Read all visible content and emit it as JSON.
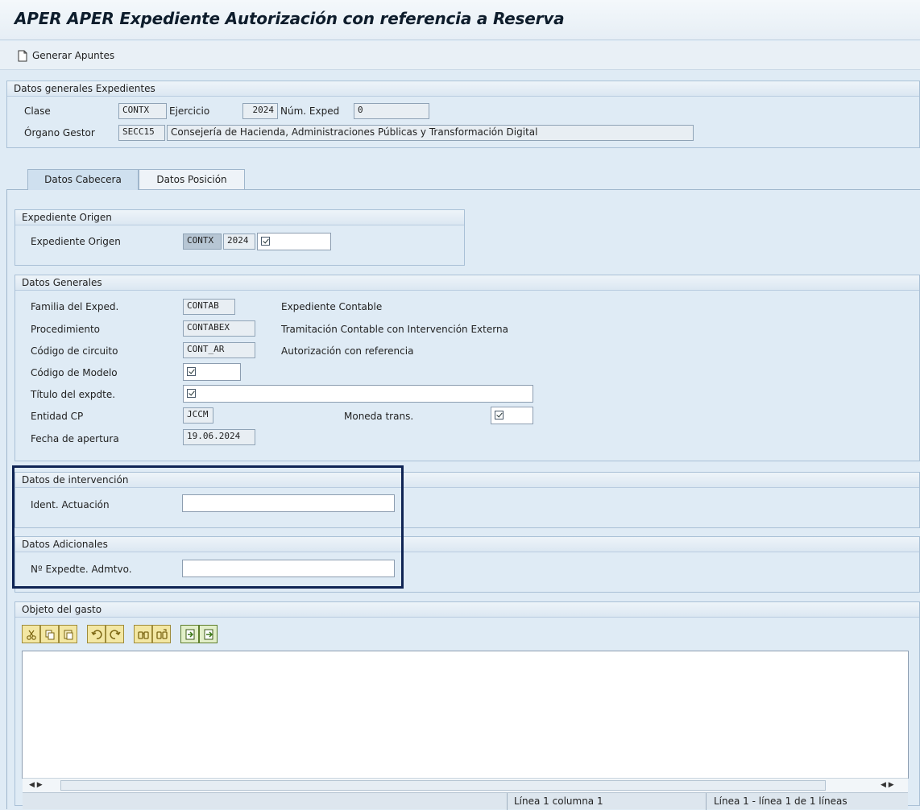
{
  "window": {
    "title": "APER APER Expediente Autorización con referencia a Reserva"
  },
  "toolbar": {
    "generate_label": "Generar Apuntes"
  },
  "general": {
    "header": "Datos generales Expedientes",
    "clase_label": "Clase",
    "clase_value": "CONTX",
    "ejercicio_label": "Ejercicio",
    "ejercicio_value": "2024",
    "num_exped_label": "Núm. Exped",
    "num_exped_value": "0",
    "organo_label": "Órgano Gestor",
    "organo_code": "SECC15",
    "organo_desc": "Consejería de Hacienda, Administraciones Públicas y Transformación Digital"
  },
  "tabs": [
    {
      "label": "Datos Cabecera",
      "active": true
    },
    {
      "label": "Datos Posición",
      "active": false
    }
  ],
  "origen": {
    "header": "Expediente Origen",
    "label": "Expediente Origen",
    "clase": "CONTX",
    "ejercicio": "2024"
  },
  "datos_generales": {
    "header": "Datos Generales",
    "familia_label": "Familia del Exped.",
    "familia_value": "CONTAB",
    "familia_desc": "Expediente Contable",
    "procedimiento_label": "Procedimiento",
    "procedimiento_value": "CONTABEX",
    "procedimiento_desc": "Tramitación Contable con Intervención Externa",
    "circuito_label": "Código de circuito",
    "circuito_value": "CONT_AR",
    "circuito_desc": "Autorización con referencia",
    "modelo_label": "Código de Modelo",
    "titulo_label": "Título del expdte.",
    "entidad_label": "Entidad CP",
    "entidad_value": "JCCM",
    "moneda_label": "Moneda trans.",
    "fecha_label": "Fecha de apertura",
    "fecha_value": "19.06.2024"
  },
  "intervencion": {
    "header": "Datos de intervención",
    "ident_label": "Ident. Actuación",
    "ident_value": ""
  },
  "adicionales": {
    "header": "Datos Adicionales",
    "expedte_label": "Nº Expedte. Admtvo.",
    "expedte_value": ""
  },
  "objeto": {
    "header": "Objeto del gasto",
    "editor_text": "",
    "status_line_col": "Línea 1 columna 1",
    "status_lines": "Línea 1 - línea 1 de 1 líneas"
  },
  "icons": {
    "editor_toolbar": [
      "cut-icon",
      "copy-icon",
      "paste-icon",
      "undo-icon",
      "redo-icon",
      "find-icon",
      "find-next-icon",
      "import-icon",
      "export-icon"
    ]
  },
  "colors": {
    "background": "#dfebf5",
    "highlight_border": "#0f2454",
    "title_text": "#0e1d2c"
  }
}
